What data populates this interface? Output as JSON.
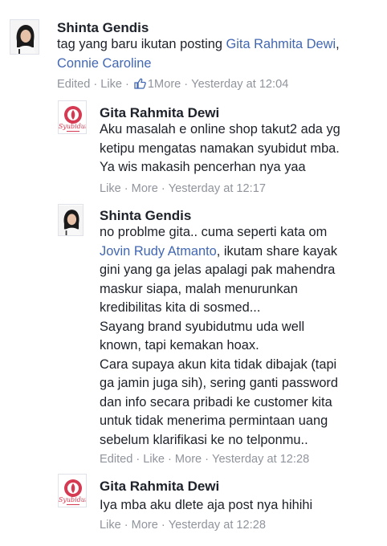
{
  "comments": [
    {
      "author": "Shinta Gendis",
      "line1": "tag yang baru ikutan posting ",
      "tag1": "Gita Rahmita Dewi",
      "line1_end": ",",
      "tag2": "Connie Caroline",
      "meta": {
        "edited": "Edited",
        "like": "Like",
        "reactions": "1",
        "more": "More",
        "time": "Yesterday at 12:04"
      }
    },
    {
      "author": "Gita Rahmita Dewi",
      "lines": [
        "Aku masalah e online shop takut2 ada yg",
        "ketipu mengatas namakan syubidut mba.",
        "Ya wis makasih pencerhan nya yaa"
      ],
      "meta": {
        "like": "Like",
        "more": "More",
        "time": "Yesterday at 12:17"
      }
    },
    {
      "author": "Shinta Gendis",
      "line1": "no problme gita.. cuma seperti kata om",
      "mention": "Jovin Rudy Atmanto",
      "line2_end": ", ikutam share kayak",
      "lines": [
        "gini yang ga jelas apalagi pak mahendra",
        "maskur siapa, malah menurunkan",
        "kredibilitas kita di sosmed...",
        "Sayang brand syubidutmu uda well",
        "known, tapi kemakan hoax.",
        "Cara supaya akun kita tidak dibajak (tapi",
        "ga jamin juga sih), sering ganti password",
        "dan info secara pribadi ke customer kita",
        "untuk tidak menerima permintaan uang",
        "sebelum klarifikasi ke no telponmu.."
      ],
      "meta": {
        "edited": "Edited",
        "like": "Like",
        "more": "More",
        "time": "Yesterday at 12:28"
      }
    },
    {
      "author": "Gita Rahmita Dewi",
      "lines": [
        "Iya mba aku dlete aja post nya hihihi"
      ],
      "meta": {
        "like": "Like",
        "more": "More",
        "time": "Yesterday at 12:28"
      }
    }
  ],
  "logo_text": "Syubidut",
  "colors": {
    "link": "#4267b2",
    "meta": "#90949c",
    "logo": "#d63a52"
  }
}
